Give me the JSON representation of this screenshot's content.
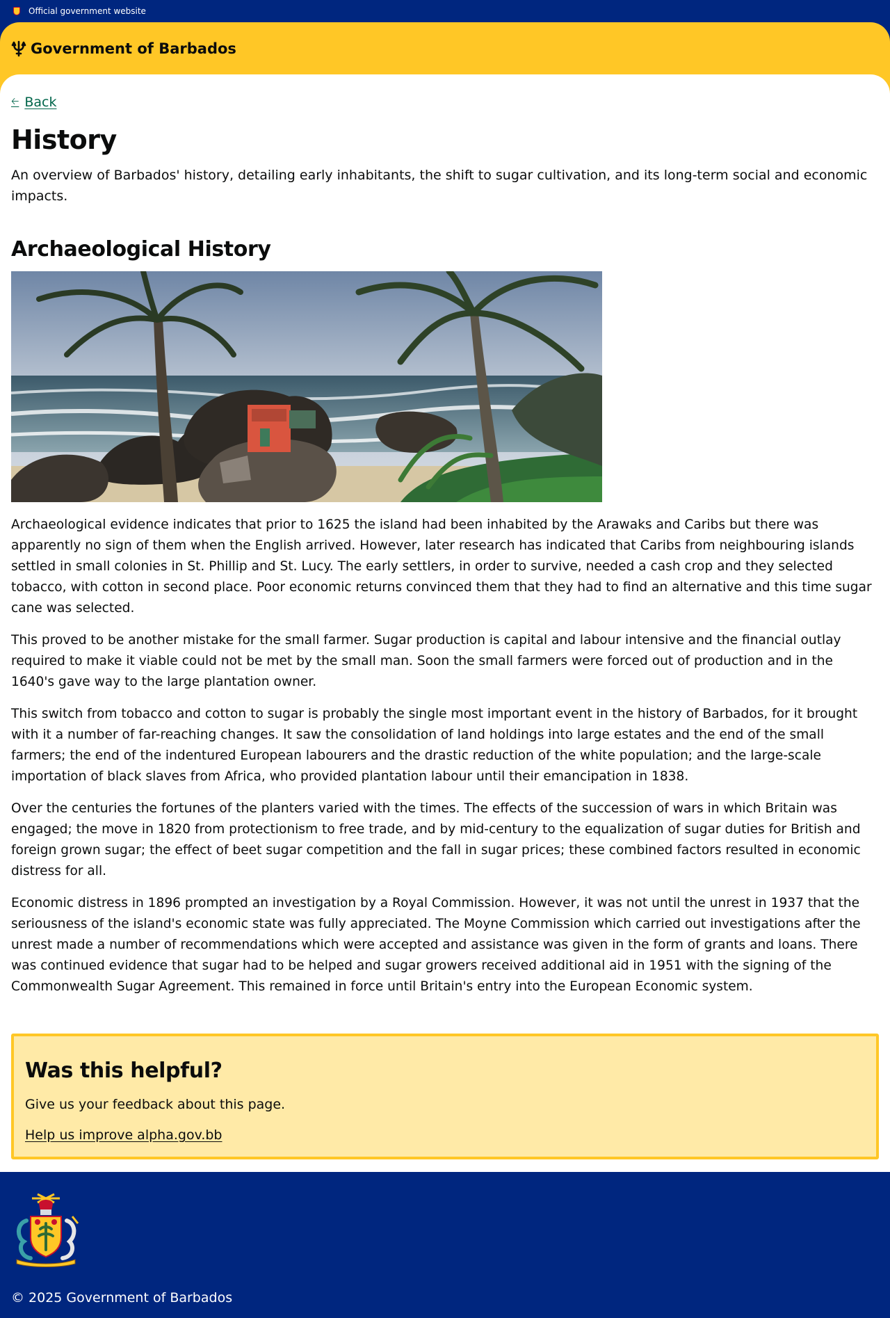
{
  "topbar": {
    "label": "Official government website",
    "crest_icon": "barbados-crest-icon"
  },
  "header": {
    "title": "Government of Barbados",
    "logo_icon": "trident-icon"
  },
  "nav": {
    "back_label": "Back",
    "back_icon": "arrow-left-icon"
  },
  "page": {
    "title": "History",
    "lead": "An overview of Barbados' history, detailing early inhabitants, the shift to sugar cultivation, and its long-term social and economic impacts."
  },
  "section": {
    "heading": "Archaeological History",
    "paragraphs": [
      "Archaeological evidence indicates that prior to 1625 the island had been inhabited by the Arawaks and Caribs but there was apparently no sign of them when the English arrived. However, later research has indicated that Caribs from neighbouring islands settled in small colonies in St. Phillip and St. Lucy. The early settlers, in order to survive, needed a cash crop and they selected tobacco, with cotton in second place. Poor economic returns convinced them that they had to find an alternative and this time sugar cane was selected.",
      "This proved to be another mistake for the small farmer. Sugar production is capital and labour intensive and the financial outlay required to make it viable could not be met by the small man. Soon the small farmers were forced out of production and in the 1640's gave way to the large plantation owner.",
      "This switch from tobacco and cotton to sugar is probably the single most important event in the history of Barbados, for it brought with it a number of far-reaching changes. It saw the consolidation of land holdings into large estates and the end of the small farmers; the end of the indentured European labourers and the drastic reduction of the white population; and the large-scale importation of black slaves from Africa, who provided plantation labour until their emancipation in 1838.",
      "Over the centuries the fortunes of the planters varied with the times. The effects of the succession of wars in which Britain was engaged; the move in 1820 from protectionism to free trade, and by mid-century to the equalization of sugar duties for British and foreign grown sugar; the effect of beet sugar competition and the fall in sugar prices; these combined factors resulted in economic distress for all.",
      "Economic distress in 1896 prompted an investigation by a Royal Commission. However, it was not until the unrest in 1937 that the seriousness of the island's economic state was fully appreciated. The Moyne Commission which carried out investigations after the unrest made a number of recommendations which were accepted and assistance was given in the form of grants and loans. There was continued evidence that sugar had to be helped and sugar growers received additional aid in 1951 with the signing of the Commonwealth Sugar Agreement. This remained in force until Britain's entry into the European Economic system."
    ]
  },
  "feedback": {
    "heading": "Was this helpful?",
    "text": "Give us your feedback about this page.",
    "link_label": "Help us improve alpha.gov.bb"
  },
  "footer": {
    "copyright": "© 2025 Government of Barbados",
    "crest_icon": "barbados-coat-of-arms-icon"
  },
  "colors": {
    "navy": "#00267f",
    "gold": "#ffc726",
    "feedback_bg": "#ffeaa7",
    "link_green": "#00654a"
  }
}
